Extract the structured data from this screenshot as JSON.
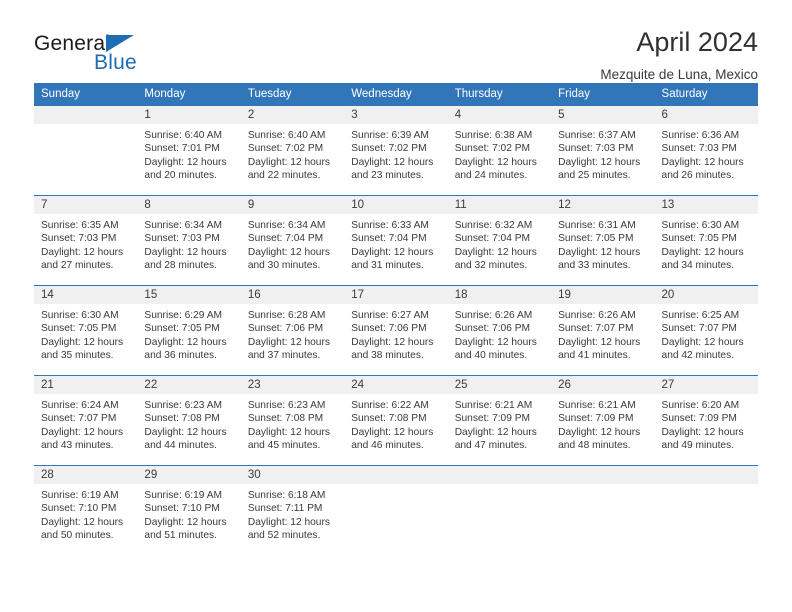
{
  "brand": {
    "name_part1": "General",
    "name_part2": "Blue",
    "accent_color": "#1d6cb5"
  },
  "header": {
    "title": "April 2024",
    "subtitle": "Mezquite de Luna, Mexico",
    "header_bg_color": "#3176b9"
  },
  "weekday_headers": [
    "Sunday",
    "Monday",
    "Tuesday",
    "Wednesday",
    "Thursday",
    "Friday",
    "Saturday"
  ],
  "weeks": [
    [
      {
        "day": "",
        "empty": true,
        "sunrise": "",
        "sunset": "",
        "daylight_line1": "",
        "daylight_line2": ""
      },
      {
        "day": "1",
        "sunrise": "Sunrise: 6:40 AM",
        "sunset": "Sunset: 7:01 PM",
        "daylight_line1": "Daylight: 12 hours",
        "daylight_line2": "and 20 minutes."
      },
      {
        "day": "2",
        "sunrise": "Sunrise: 6:40 AM",
        "sunset": "Sunset: 7:02 PM",
        "daylight_line1": "Daylight: 12 hours",
        "daylight_line2": "and 22 minutes."
      },
      {
        "day": "3",
        "sunrise": "Sunrise: 6:39 AM",
        "sunset": "Sunset: 7:02 PM",
        "daylight_line1": "Daylight: 12 hours",
        "daylight_line2": "and 23 minutes."
      },
      {
        "day": "4",
        "sunrise": "Sunrise: 6:38 AM",
        "sunset": "Sunset: 7:02 PM",
        "daylight_line1": "Daylight: 12 hours",
        "daylight_line2": "and 24 minutes."
      },
      {
        "day": "5",
        "sunrise": "Sunrise: 6:37 AM",
        "sunset": "Sunset: 7:03 PM",
        "daylight_line1": "Daylight: 12 hours",
        "daylight_line2": "and 25 minutes."
      },
      {
        "day": "6",
        "sunrise": "Sunrise: 6:36 AM",
        "sunset": "Sunset: 7:03 PM",
        "daylight_line1": "Daylight: 12 hours",
        "daylight_line2": "and 26 minutes."
      }
    ],
    [
      {
        "day": "7",
        "sunrise": "Sunrise: 6:35 AM",
        "sunset": "Sunset: 7:03 PM",
        "daylight_line1": "Daylight: 12 hours",
        "daylight_line2": "and 27 minutes."
      },
      {
        "day": "8",
        "sunrise": "Sunrise: 6:34 AM",
        "sunset": "Sunset: 7:03 PM",
        "daylight_line1": "Daylight: 12 hours",
        "daylight_line2": "and 28 minutes."
      },
      {
        "day": "9",
        "sunrise": "Sunrise: 6:34 AM",
        "sunset": "Sunset: 7:04 PM",
        "daylight_line1": "Daylight: 12 hours",
        "daylight_line2": "and 30 minutes."
      },
      {
        "day": "10",
        "sunrise": "Sunrise: 6:33 AM",
        "sunset": "Sunset: 7:04 PM",
        "daylight_line1": "Daylight: 12 hours",
        "daylight_line2": "and 31 minutes."
      },
      {
        "day": "11",
        "sunrise": "Sunrise: 6:32 AM",
        "sunset": "Sunset: 7:04 PM",
        "daylight_line1": "Daylight: 12 hours",
        "daylight_line2": "and 32 minutes."
      },
      {
        "day": "12",
        "sunrise": "Sunrise: 6:31 AM",
        "sunset": "Sunset: 7:05 PM",
        "daylight_line1": "Daylight: 12 hours",
        "daylight_line2": "and 33 minutes."
      },
      {
        "day": "13",
        "sunrise": "Sunrise: 6:30 AM",
        "sunset": "Sunset: 7:05 PM",
        "daylight_line1": "Daylight: 12 hours",
        "daylight_line2": "and 34 minutes."
      }
    ],
    [
      {
        "day": "14",
        "sunrise": "Sunrise: 6:30 AM",
        "sunset": "Sunset: 7:05 PM",
        "daylight_line1": "Daylight: 12 hours",
        "daylight_line2": "and 35 minutes."
      },
      {
        "day": "15",
        "sunrise": "Sunrise: 6:29 AM",
        "sunset": "Sunset: 7:05 PM",
        "daylight_line1": "Daylight: 12 hours",
        "daylight_line2": "and 36 minutes."
      },
      {
        "day": "16",
        "sunrise": "Sunrise: 6:28 AM",
        "sunset": "Sunset: 7:06 PM",
        "daylight_line1": "Daylight: 12 hours",
        "daylight_line2": "and 37 minutes."
      },
      {
        "day": "17",
        "sunrise": "Sunrise: 6:27 AM",
        "sunset": "Sunset: 7:06 PM",
        "daylight_line1": "Daylight: 12 hours",
        "daylight_line2": "and 38 minutes."
      },
      {
        "day": "18",
        "sunrise": "Sunrise: 6:26 AM",
        "sunset": "Sunset: 7:06 PM",
        "daylight_line1": "Daylight: 12 hours",
        "daylight_line2": "and 40 minutes."
      },
      {
        "day": "19",
        "sunrise": "Sunrise: 6:26 AM",
        "sunset": "Sunset: 7:07 PM",
        "daylight_line1": "Daylight: 12 hours",
        "daylight_line2": "and 41 minutes."
      },
      {
        "day": "20",
        "sunrise": "Sunrise: 6:25 AM",
        "sunset": "Sunset: 7:07 PM",
        "daylight_line1": "Daylight: 12 hours",
        "daylight_line2": "and 42 minutes."
      }
    ],
    [
      {
        "day": "21",
        "sunrise": "Sunrise: 6:24 AM",
        "sunset": "Sunset: 7:07 PM",
        "daylight_line1": "Daylight: 12 hours",
        "daylight_line2": "and 43 minutes."
      },
      {
        "day": "22",
        "sunrise": "Sunrise: 6:23 AM",
        "sunset": "Sunset: 7:08 PM",
        "daylight_line1": "Daylight: 12 hours",
        "daylight_line2": "and 44 minutes."
      },
      {
        "day": "23",
        "sunrise": "Sunrise: 6:23 AM",
        "sunset": "Sunset: 7:08 PM",
        "daylight_line1": "Daylight: 12 hours",
        "daylight_line2": "and 45 minutes."
      },
      {
        "day": "24",
        "sunrise": "Sunrise: 6:22 AM",
        "sunset": "Sunset: 7:08 PM",
        "daylight_line1": "Daylight: 12 hours",
        "daylight_line2": "and 46 minutes."
      },
      {
        "day": "25",
        "sunrise": "Sunrise: 6:21 AM",
        "sunset": "Sunset: 7:09 PM",
        "daylight_line1": "Daylight: 12 hours",
        "daylight_line2": "and 47 minutes."
      },
      {
        "day": "26",
        "sunrise": "Sunrise: 6:21 AM",
        "sunset": "Sunset: 7:09 PM",
        "daylight_line1": "Daylight: 12 hours",
        "daylight_line2": "and 48 minutes."
      },
      {
        "day": "27",
        "sunrise": "Sunrise: 6:20 AM",
        "sunset": "Sunset: 7:09 PM",
        "daylight_line1": "Daylight: 12 hours",
        "daylight_line2": "and 49 minutes."
      }
    ],
    [
      {
        "day": "28",
        "sunrise": "Sunrise: 6:19 AM",
        "sunset": "Sunset: 7:10 PM",
        "daylight_line1": "Daylight: 12 hours",
        "daylight_line2": "and 50 minutes."
      },
      {
        "day": "29",
        "sunrise": "Sunrise: 6:19 AM",
        "sunset": "Sunset: 7:10 PM",
        "daylight_line1": "Daylight: 12 hours",
        "daylight_line2": "and 51 minutes."
      },
      {
        "day": "30",
        "sunrise": "Sunrise: 6:18 AM",
        "sunset": "Sunset: 7:11 PM",
        "daylight_line1": "Daylight: 12 hours",
        "daylight_line2": "and 52 minutes."
      },
      {
        "day": "",
        "empty": true,
        "sunrise": "",
        "sunset": "",
        "daylight_line1": "",
        "daylight_line2": ""
      },
      {
        "day": "",
        "empty": true,
        "sunrise": "",
        "sunset": "",
        "daylight_line1": "",
        "daylight_line2": ""
      },
      {
        "day": "",
        "empty": true,
        "sunrise": "",
        "sunset": "",
        "daylight_line1": "",
        "daylight_line2": ""
      },
      {
        "day": "",
        "empty": true,
        "sunrise": "",
        "sunset": "",
        "daylight_line1": "",
        "daylight_line2": ""
      }
    ]
  ]
}
